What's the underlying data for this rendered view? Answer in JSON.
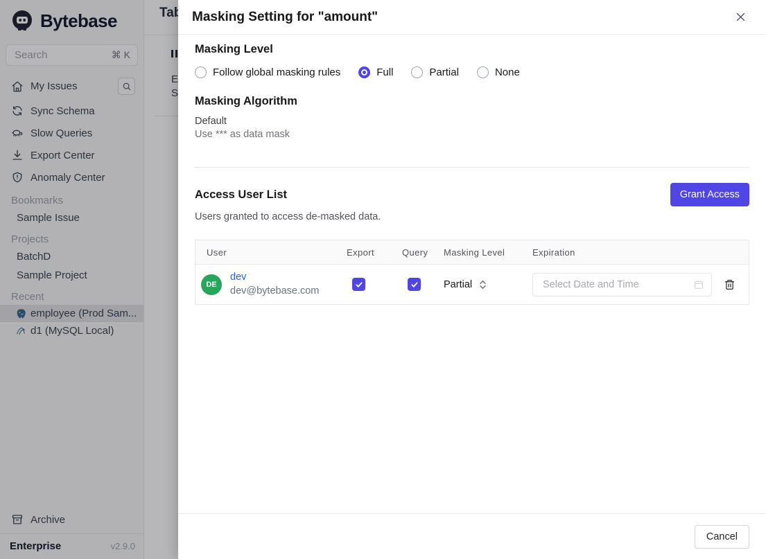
{
  "app": {
    "brand": "Bytebase",
    "plan": "Enterprise",
    "version": "v2.9.0"
  },
  "colors": {
    "accent": "#4f46e5",
    "link": "#2563eb",
    "avatar_green": "#26a65b"
  },
  "sidebar": {
    "search": {
      "placeholder": "Search",
      "shortcut": "⌘ K"
    },
    "nav": [
      {
        "label": "My Issues",
        "icon": "home-icon"
      },
      {
        "label": "Sync Schema",
        "icon": "sync-icon"
      },
      {
        "label": "Slow Queries",
        "icon": "turtle-icon"
      },
      {
        "label": "Export Center",
        "icon": "download-icon"
      },
      {
        "label": "Anomaly Center",
        "icon": "shield-icon"
      }
    ],
    "sections": [
      {
        "title": "Bookmarks",
        "items": [
          "Sample Issue"
        ]
      },
      {
        "title": "Projects",
        "items": [
          "BatchD",
          "Sample Project"
        ]
      },
      {
        "title": "Recent"
      }
    ],
    "recent_dbs": [
      {
        "label": "employee (Prod Sam...",
        "icon": "postgres-icon",
        "selected": true
      },
      {
        "label": "d1 (MySQL Local)",
        "icon": "mysql-icon",
        "selected": false
      }
    ],
    "archive_label": "Archive"
  },
  "background_page": {
    "title": "Tab",
    "fragment1": "E",
    "fragment2": "S"
  },
  "modal": {
    "title": "Masking Setting for \"amount\"",
    "masking_level": {
      "heading": "Masking Level",
      "options": [
        {
          "label": "Follow global masking rules",
          "selected": false
        },
        {
          "label": "Full",
          "selected": true
        },
        {
          "label": "Partial",
          "selected": false
        },
        {
          "label": "None",
          "selected": false
        }
      ]
    },
    "masking_algorithm": {
      "heading": "Masking Algorithm",
      "name": "Default",
      "description": "Use *** as data mask"
    },
    "access_user_list": {
      "heading": "Access User List",
      "subtitle": "Users granted to access de-masked data.",
      "grant_button": "Grant Access",
      "table": {
        "columns": [
          "User",
          "Export",
          "Query",
          "Masking Level",
          "Expiration"
        ],
        "rows": [
          {
            "avatar_initials": "DE",
            "name": "dev",
            "email": "dev@bytebase.com",
            "export_checked": true,
            "query_checked": true,
            "masking_level": "Partial",
            "expiration_placeholder": "Select Date and Time"
          }
        ]
      }
    },
    "cancel_button": "Cancel"
  }
}
